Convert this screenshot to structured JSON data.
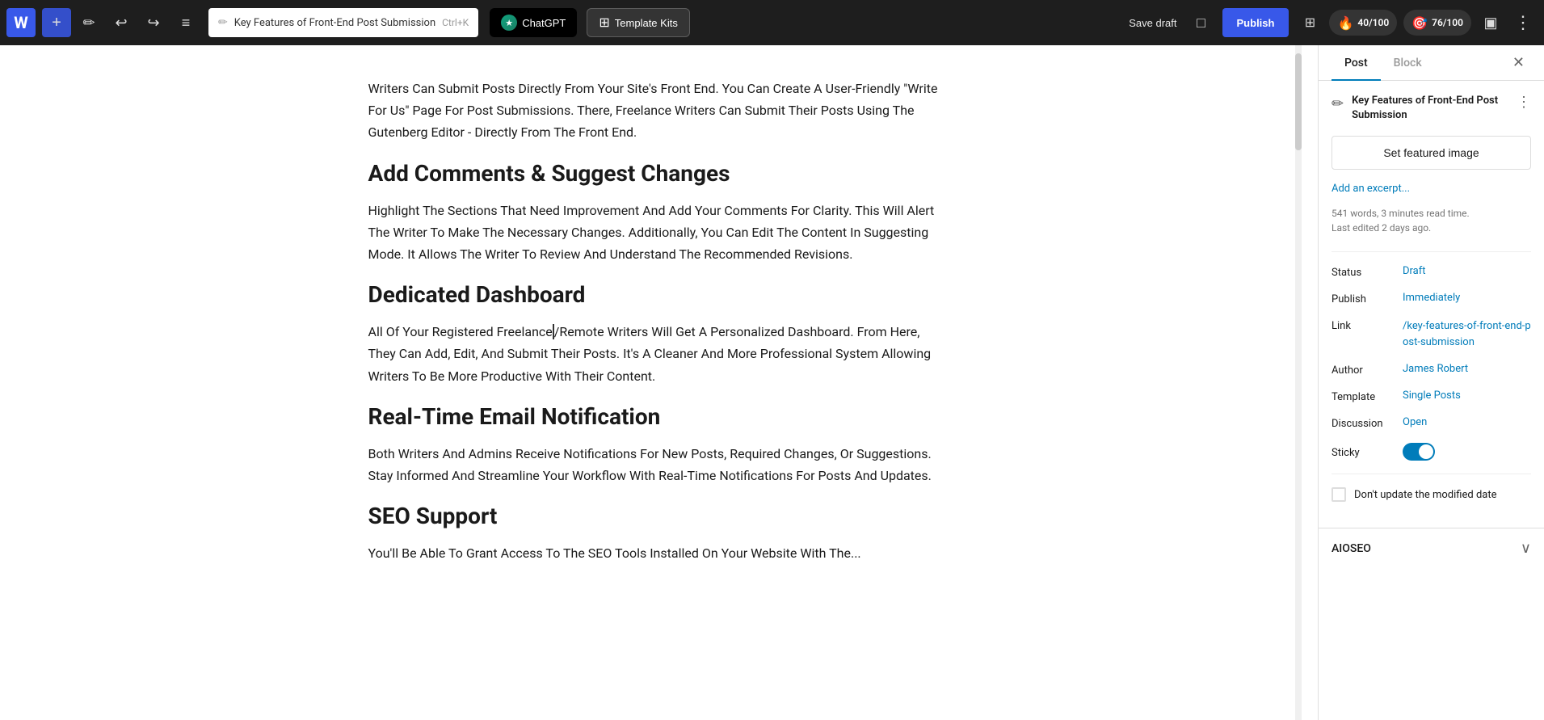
{
  "toolbar": {
    "wp_logo": "W",
    "add_block_label": "+",
    "tools_label": "✏",
    "undo_label": "↩",
    "redo_label": "↪",
    "document_overview_label": "≡",
    "post_title": "Key Features of Front-End Post Submission",
    "shortcut": "Ctrl+K",
    "chatgpt_label": "ChatGPT",
    "template_kits_label": "Template Kits",
    "save_draft_label": "Save draft",
    "publish_label": "Publish",
    "view_icon": "□",
    "puzzle_icon": "⊞",
    "score1_label": "40/100",
    "score2_label": "76/100",
    "more_options_label": "⋮"
  },
  "editor": {
    "sections": [
      {
        "type": "paragraph",
        "text": "Writers Can Submit Posts Directly From Your Site's Front End. You Can Create A User-Friendly \"Write For Us\" Page For Post Submissions. There, Freelance Writers Can Submit Their Posts Using The Gutenberg Editor - Directly From The Front End."
      },
      {
        "type": "heading",
        "text": "Add Comments & Suggest Changes"
      },
      {
        "type": "paragraph",
        "text": "Highlight The Sections That Need Improvement And Add Your Comments For Clarity. This Will Alert The Writer To Make The Necessary Changes. Additionally, You Can Edit The Content In Suggesting Mode. It Allows The Writer To Review And Understand The Recommended Revisions."
      },
      {
        "type": "heading",
        "text": "Dedicated Dashboard"
      },
      {
        "type": "paragraph",
        "text": "All Of Your Registered Freelance/Remote Writers Will Get A Personalized Dashboard. From Here, They Can Add, Edit, And Submit Their Posts. It's A Cleaner And More Professional System Allowing Writers To Be More Productive With Their Content."
      },
      {
        "type": "heading",
        "text": "Real-Time Email Notification"
      },
      {
        "type": "paragraph",
        "text": "Both Writers And Admins Receive Notifications For New Posts, Required Changes, Or Suggestions. Stay Informed And Streamline Your Workflow With Real-Time Notifications For Posts And Updates."
      },
      {
        "type": "heading",
        "text": "SEO Support"
      },
      {
        "type": "paragraph",
        "text": "You'll Be Able To Grant Access To The SEO Tools Installed On Your Website With The..."
      }
    ]
  },
  "sidebar": {
    "tab_post_label": "Post",
    "tab_block_label": "Block",
    "close_label": "✕",
    "doc_title": "Key Features of Front-End Post Submission",
    "doc_menu_label": "⋮",
    "featured_image_label": "Set featured image",
    "add_excerpt_label": "Add an excerpt...",
    "word_count_info": "541 words, 3 minutes read time.\nLast edited 2 days ago.",
    "status_label": "Status",
    "status_value": "Draft",
    "publish_label": "Publish",
    "publish_value": "Immediately",
    "link_label": "Link",
    "link_value": "/key-features-of-front-end-post-submission",
    "author_label": "Author",
    "author_value": "James Robert",
    "template_label": "Template",
    "template_value": "Single Posts",
    "discussion_label": "Discussion",
    "discussion_value": "Open",
    "sticky_label": "Sticky",
    "sticky_enabled": true,
    "dont_update_date_label": "Don't update the modified date",
    "aioseo_label": "AIOSEO",
    "aioseo_chevron": "∨"
  }
}
